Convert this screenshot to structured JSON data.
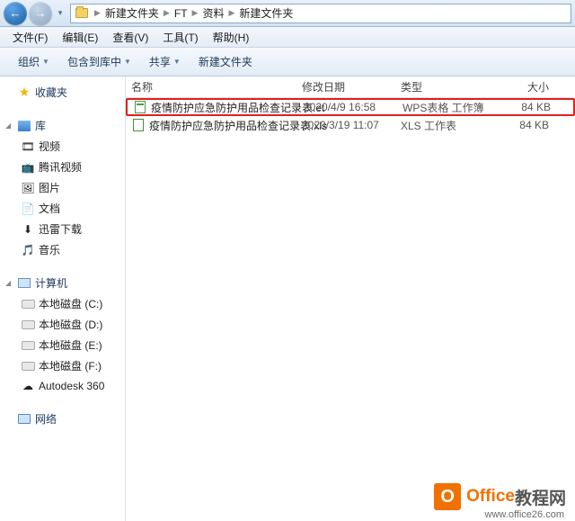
{
  "titlebar": {
    "crumbs": [
      "新建文件夹",
      "FT",
      "资料",
      "新建文件夹"
    ]
  },
  "menu": {
    "file": "文件(F)",
    "edit": "编辑(E)",
    "view": "查看(V)",
    "tools": "工具(T)",
    "help": "帮助(H)"
  },
  "toolbar": {
    "organize": "组织",
    "include": "包含到库中",
    "share": "共享",
    "newfolder": "新建文件夹"
  },
  "nav": {
    "favorites": "收藏夹",
    "libraries": "库",
    "lib_items": {
      "videos": "视频",
      "tencent": "腾讯视频",
      "pictures": "图片",
      "documents": "文档",
      "thunder": "迅雷下载",
      "music": "音乐"
    },
    "computer": "计算机",
    "drives": {
      "c": "本地磁盘 (C:)",
      "d": "本地磁盘 (D:)",
      "e": "本地磁盘 (E:)",
      "f": "本地磁盘 (F:)",
      "autodesk": "Autodesk 360"
    },
    "network": "网络"
  },
  "columns": {
    "name": "名称",
    "date": "修改日期",
    "type": "类型",
    "size": "大小"
  },
  "files": [
    {
      "name": "疫情防护应急防护用品检查记录表.et",
      "date": "2020/4/9 16:58",
      "type": "WPS表格 工作簿",
      "size": "84 KB",
      "highlight": true
    },
    {
      "name": "疫情防护应急防护用品检查记录表.xls",
      "date": "2020/3/19 11:07",
      "type": "XLS 工作表",
      "size": "84 KB",
      "highlight": false
    }
  ],
  "watermark": {
    "logo_letter": "O",
    "brand1": "Office",
    "brand2": "教程网",
    "url": "www.office26.com"
  }
}
